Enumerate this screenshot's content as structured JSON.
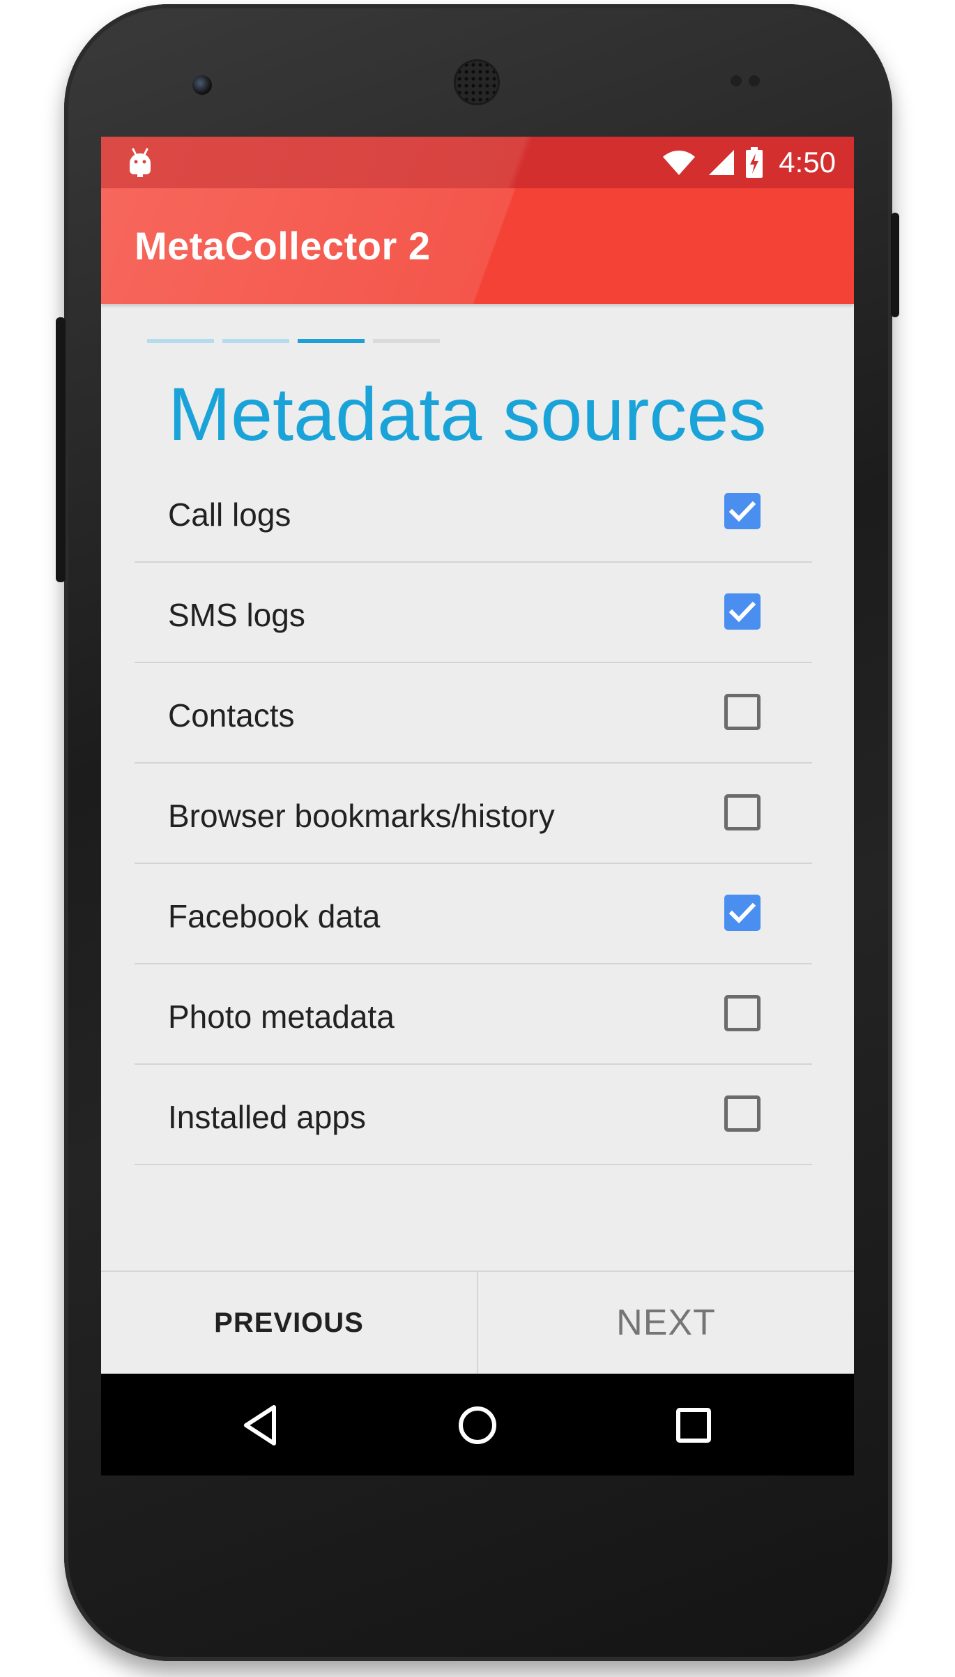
{
  "status_bar": {
    "time": "4:50",
    "icons": [
      "android-debug-icon",
      "wifi-icon",
      "signal-icon",
      "battery-charging-icon"
    ]
  },
  "app_bar": {
    "title": "MetaCollector 2"
  },
  "wizard": {
    "step_total": 4,
    "current_step": 3,
    "colors": {
      "done": "#b3dcef",
      "current": "#1ea0d6",
      "upcoming": "#dadada"
    }
  },
  "section_title": "Metadata sources",
  "sources": [
    {
      "label": "Call logs",
      "checked": true
    },
    {
      "label": "SMS logs",
      "checked": true
    },
    {
      "label": "Contacts",
      "checked": false
    },
    {
      "label": "Browser bookmarks/history",
      "checked": false
    },
    {
      "label": "Facebook data",
      "checked": true
    },
    {
      "label": "Photo metadata",
      "checked": false
    },
    {
      "label": "Installed apps",
      "checked": false
    }
  ],
  "footer": {
    "previous_label": "PREVIOUS",
    "next_label": "NEXT"
  },
  "nav_bar": {
    "icons": [
      "back-icon",
      "home-icon",
      "recents-icon"
    ]
  },
  "theme": {
    "accent": "#1aa3d8",
    "app_bar": "#f44336",
    "status_bar": "#d32f2f",
    "checkbox_on": "#4a8ff0"
  }
}
